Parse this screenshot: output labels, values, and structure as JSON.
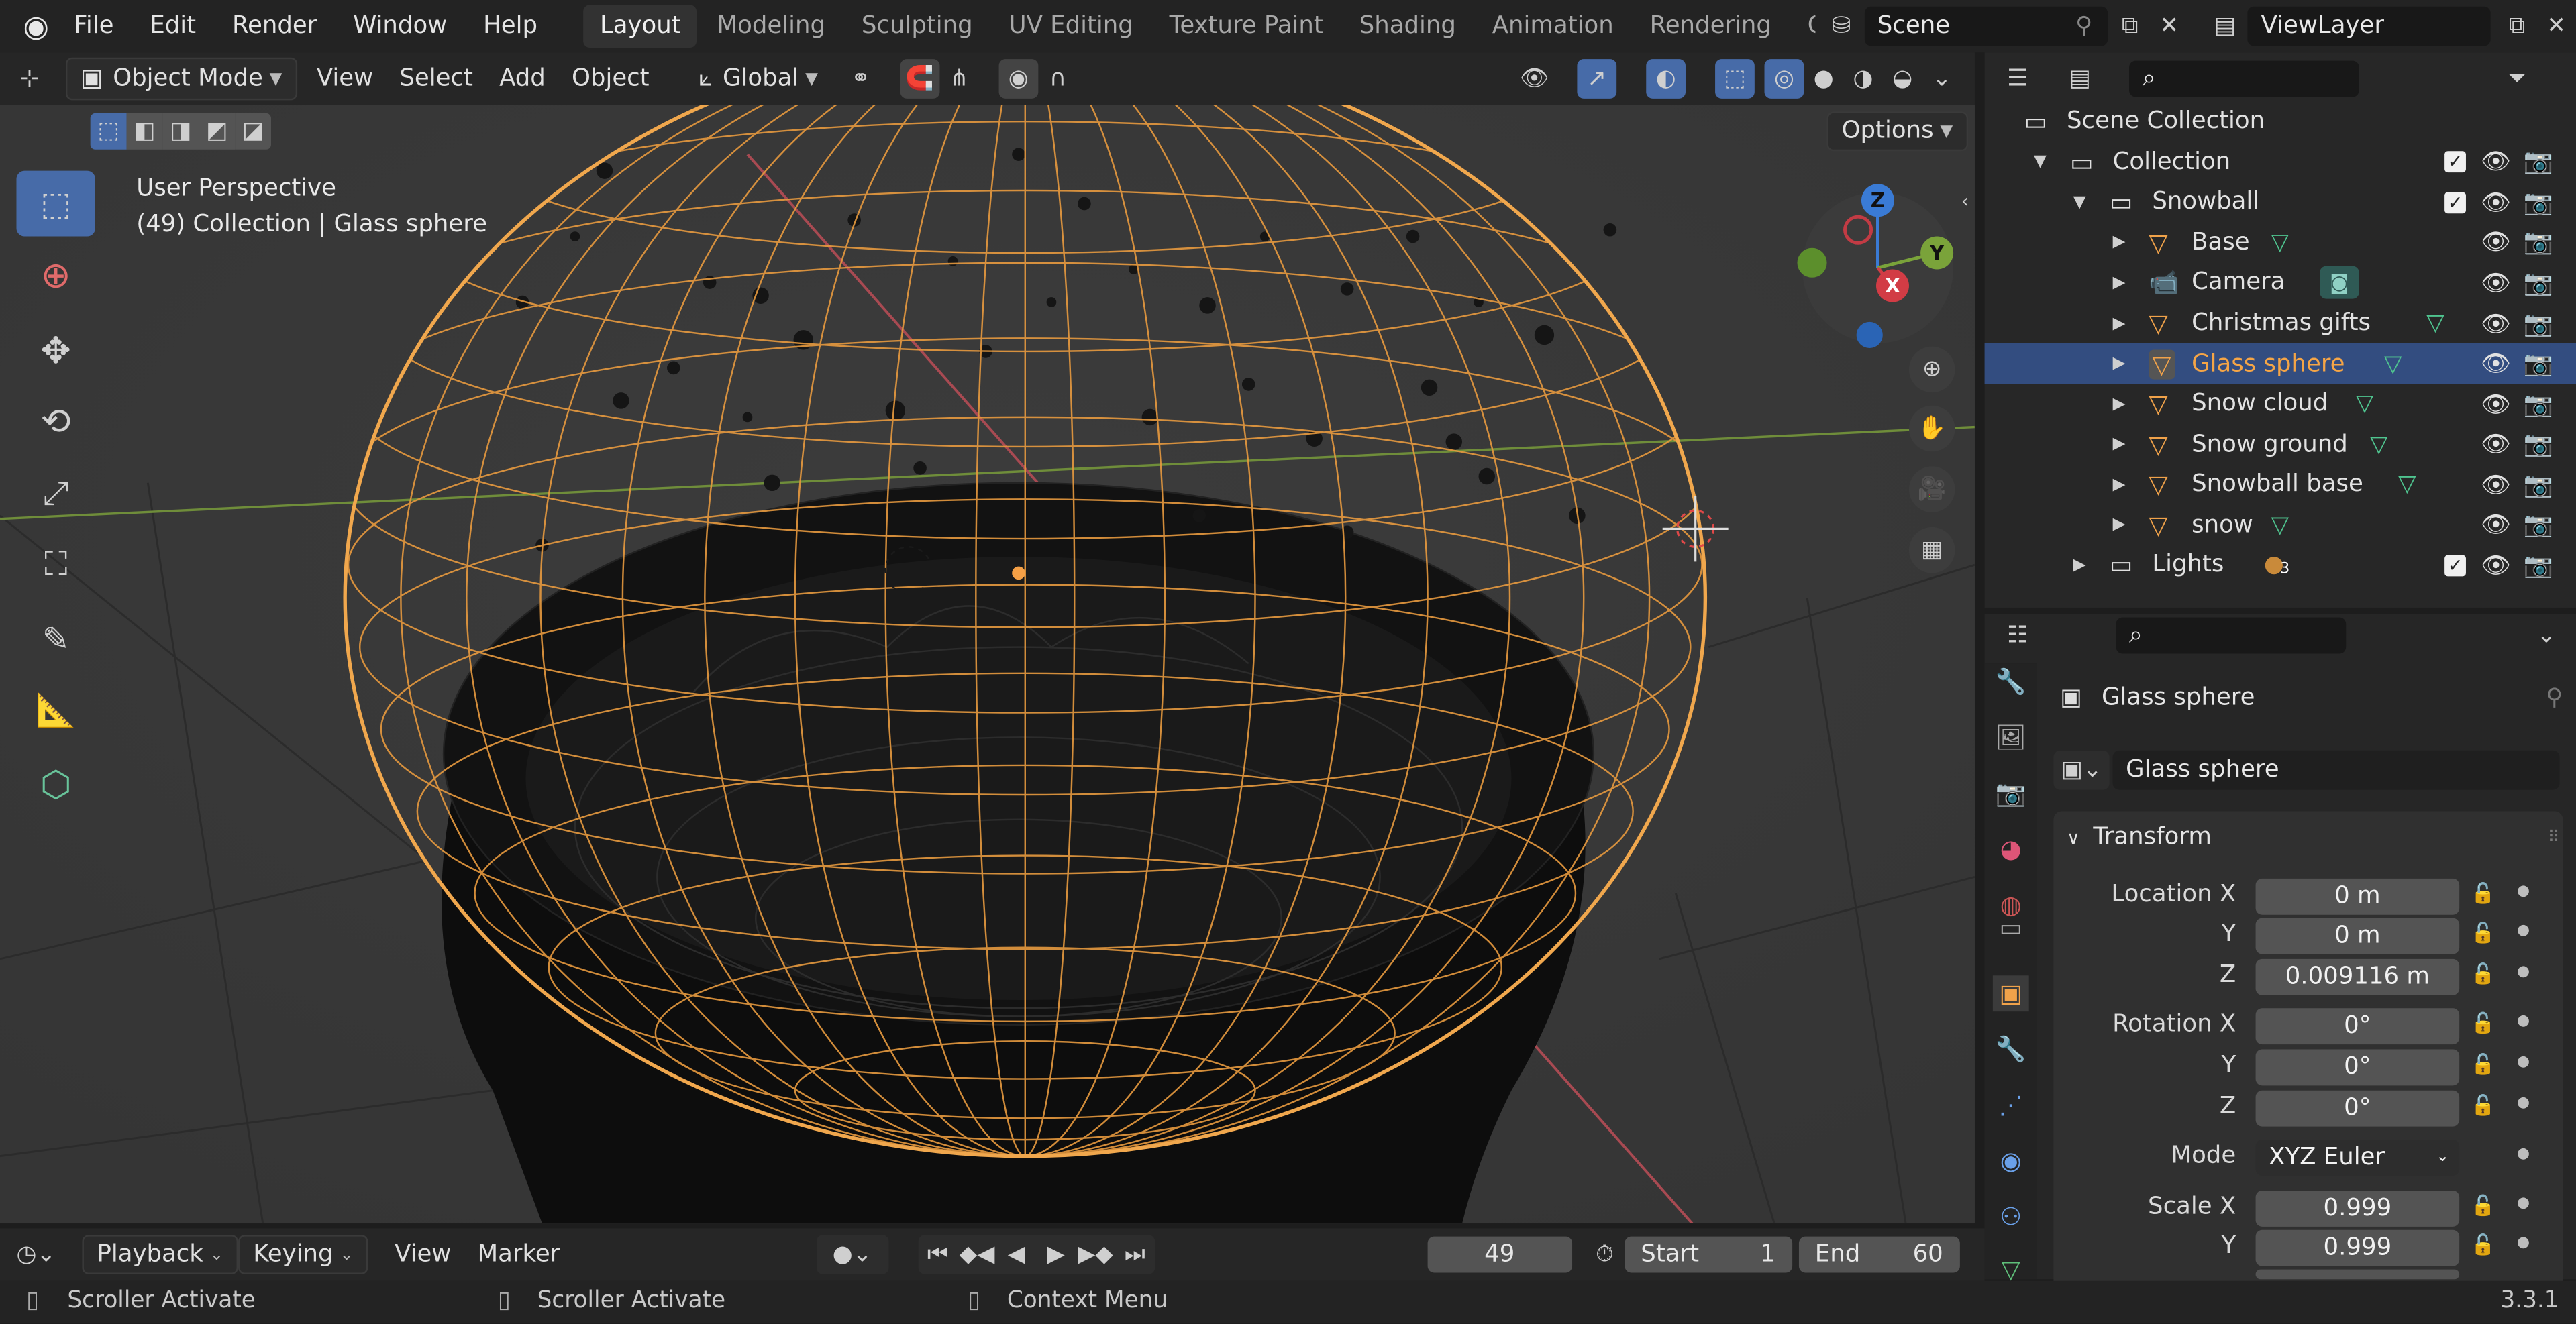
{
  "app_menu": [
    "File",
    "Edit",
    "Render",
    "Window",
    "Help"
  ],
  "workspaces": {
    "tabs": [
      "Layout",
      "Modeling",
      "Sculpting",
      "UV Editing",
      "Texture Paint",
      "Shading",
      "Animation",
      "Rendering",
      "Comp"
    ],
    "active": "Layout"
  },
  "scene": {
    "name": "Scene"
  },
  "view_layer": {
    "name": "ViewLayer"
  },
  "viewport_header": {
    "mode": "Object Mode",
    "menus": [
      "View",
      "Select",
      "Add",
      "Object"
    ],
    "transform_orientation": "Global",
    "options_label": "Options"
  },
  "viewport": {
    "perspective": "User Perspective",
    "context": "(49) Collection | Glass sphere",
    "gizmo": {
      "x": "X",
      "y": "Y",
      "z": "Z"
    }
  },
  "outliner": {
    "rows": [
      {
        "label": "Scene Collection",
        "icon": "scene-collection-icon",
        "depth": 0
      },
      {
        "label": "Collection",
        "icon": "collection-icon",
        "depth": 1
      },
      {
        "label": "Snowball",
        "icon": "collection-icon",
        "depth": 2
      },
      {
        "label": "Base",
        "icon": "mesh-object-icon",
        "depth": 3
      },
      {
        "label": "Camera",
        "icon": "camera-object-icon",
        "depth": 3
      },
      {
        "label": "Christmas gifts",
        "icon": "mesh-object-icon",
        "depth": 3
      },
      {
        "label": "Glass sphere",
        "icon": "mesh-object-icon",
        "depth": 3,
        "selected": true
      },
      {
        "label": "Snow cloud",
        "icon": "mesh-object-icon",
        "depth": 3
      },
      {
        "label": "Snow ground",
        "icon": "mesh-object-icon",
        "depth": 3
      },
      {
        "label": "Snowball base",
        "icon": "mesh-object-icon",
        "depth": 3
      },
      {
        "label": "snow",
        "icon": "mesh-object-icon",
        "depth": 3
      },
      {
        "label": "Lights",
        "icon": "collection-icon",
        "depth": 2,
        "badge": "3"
      }
    ]
  },
  "properties": {
    "object_name": "Glass sphere",
    "data_name": "Glass sphere",
    "section": "Transform",
    "location": {
      "label": "Location X",
      "x": "0 m",
      "y": "0 m",
      "z": "0.009116 m"
    },
    "rotation": {
      "label": "Rotation X",
      "x": "0°",
      "y": "0°",
      "z": "0°"
    },
    "mode": {
      "label": "Mode",
      "value": "XYZ Euler"
    },
    "scale": {
      "label": "Scale X",
      "x": "0.999",
      "y": "0.999"
    },
    "axis_y": "Y",
    "axis_z": "Z"
  },
  "timeline": {
    "menus": [
      "Playback",
      "Keying",
      "View",
      "Marker"
    ],
    "current_frame": "49",
    "start_label": "Start",
    "start": "1",
    "end_label": "End",
    "end": "60"
  },
  "status": {
    "items": [
      "Scroller Activate",
      "Scroller Activate",
      "Context Menu"
    ],
    "version": "3.3.1"
  },
  "colors": {
    "accent": "#476ba8",
    "selection": "#f5a046",
    "selected_row": "#334d80"
  }
}
